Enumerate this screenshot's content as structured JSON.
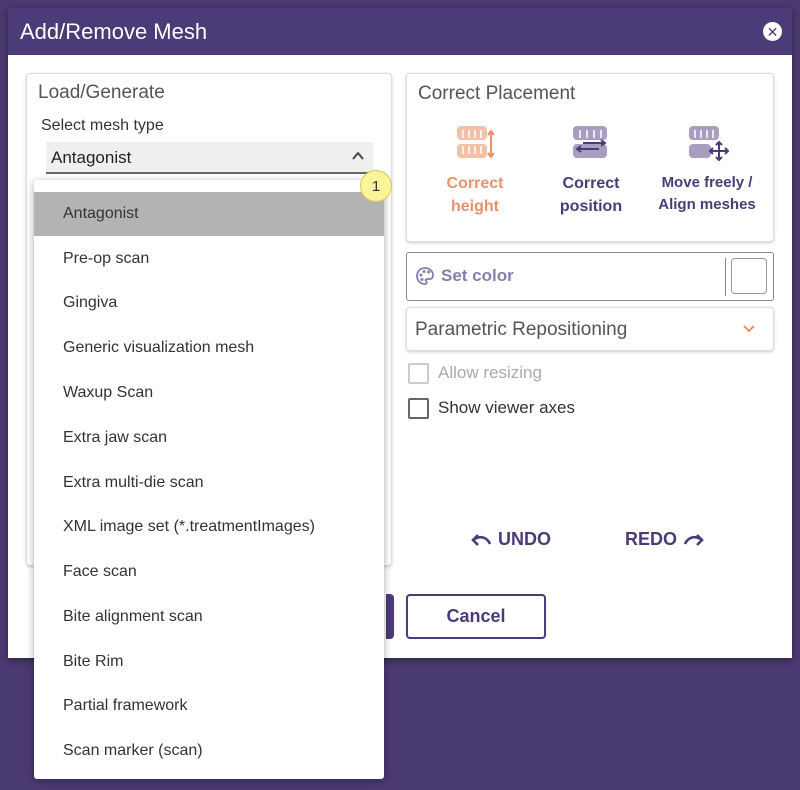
{
  "dialog": {
    "title": "Add/Remove Mesh",
    "close_icon": "close-icon"
  },
  "load_generate": {
    "title": "Load/Generate",
    "select_label": "Select mesh type",
    "select_value": "Antagonist"
  },
  "correct_placement": {
    "title": "Correct Placement",
    "buttons": [
      {
        "line1": "Correct",
        "line2": "height",
        "icon": "teeth-height-icon",
        "color": "#e8926a"
      },
      {
        "line1": "Correct",
        "line2": "position",
        "icon": "teeth-position-icon",
        "color": "#4b3b78"
      },
      {
        "line1": "Move freely /",
        "line2": "Align meshes",
        "icon": "teeth-move-icon",
        "color": "#4b3b78"
      }
    ]
  },
  "set_color": {
    "label": "Set color",
    "icon": "palette-icon"
  },
  "parametric": {
    "label": "Parametric Repositioning"
  },
  "checkboxes": {
    "allow_resizing": "Allow resizing",
    "show_axes": "Show viewer axes"
  },
  "history": {
    "undo": "UNDO",
    "redo": "REDO"
  },
  "footer": {
    "cancel": "Cancel"
  },
  "dropdown": {
    "items": [
      "Antagonist",
      "Pre-op scan",
      "Gingiva",
      "Generic visualization mesh",
      "Waxup Scan",
      "Extra jaw scan",
      "Extra multi-die scan",
      "XML image set (*.treatmentImages)",
      "Face scan",
      "Bite alignment scan",
      "Bite Rim",
      "Partial framework",
      "Scan marker (scan)"
    ],
    "selected_index": 0
  },
  "badge": {
    "number": "1"
  },
  "colors": {
    "accent": "#4b3b78",
    "highlight": "#e8926a"
  }
}
